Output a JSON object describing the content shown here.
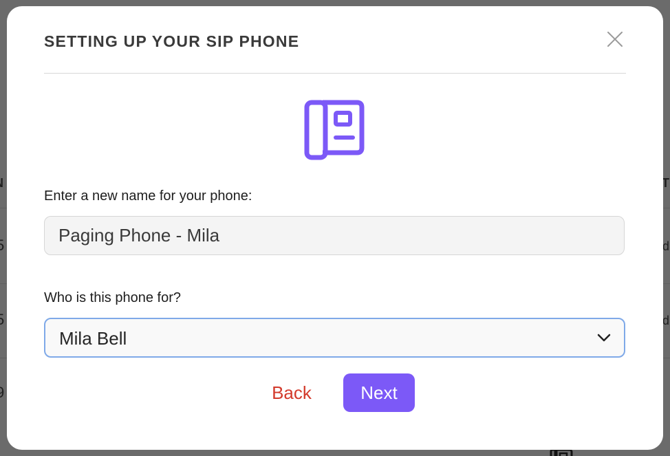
{
  "dialog": {
    "title": "SETTING UP YOUR SIP PHONE",
    "icon": "desk-phone-icon",
    "accent_color": "#7c59f7"
  },
  "name_field": {
    "label": "Enter a new name for your phone:",
    "value": "Paging Phone - Mila"
  },
  "owner_field": {
    "label": "Who is this phone for?",
    "selected": "Mila Bell"
  },
  "actions": {
    "back_label": "Back",
    "next_label": "Next",
    "back_color": "#d33a2c"
  },
  "background": {
    "fragments": [
      "N",
      "T",
      "5",
      "d",
      "5",
      "d",
      "9"
    ]
  }
}
